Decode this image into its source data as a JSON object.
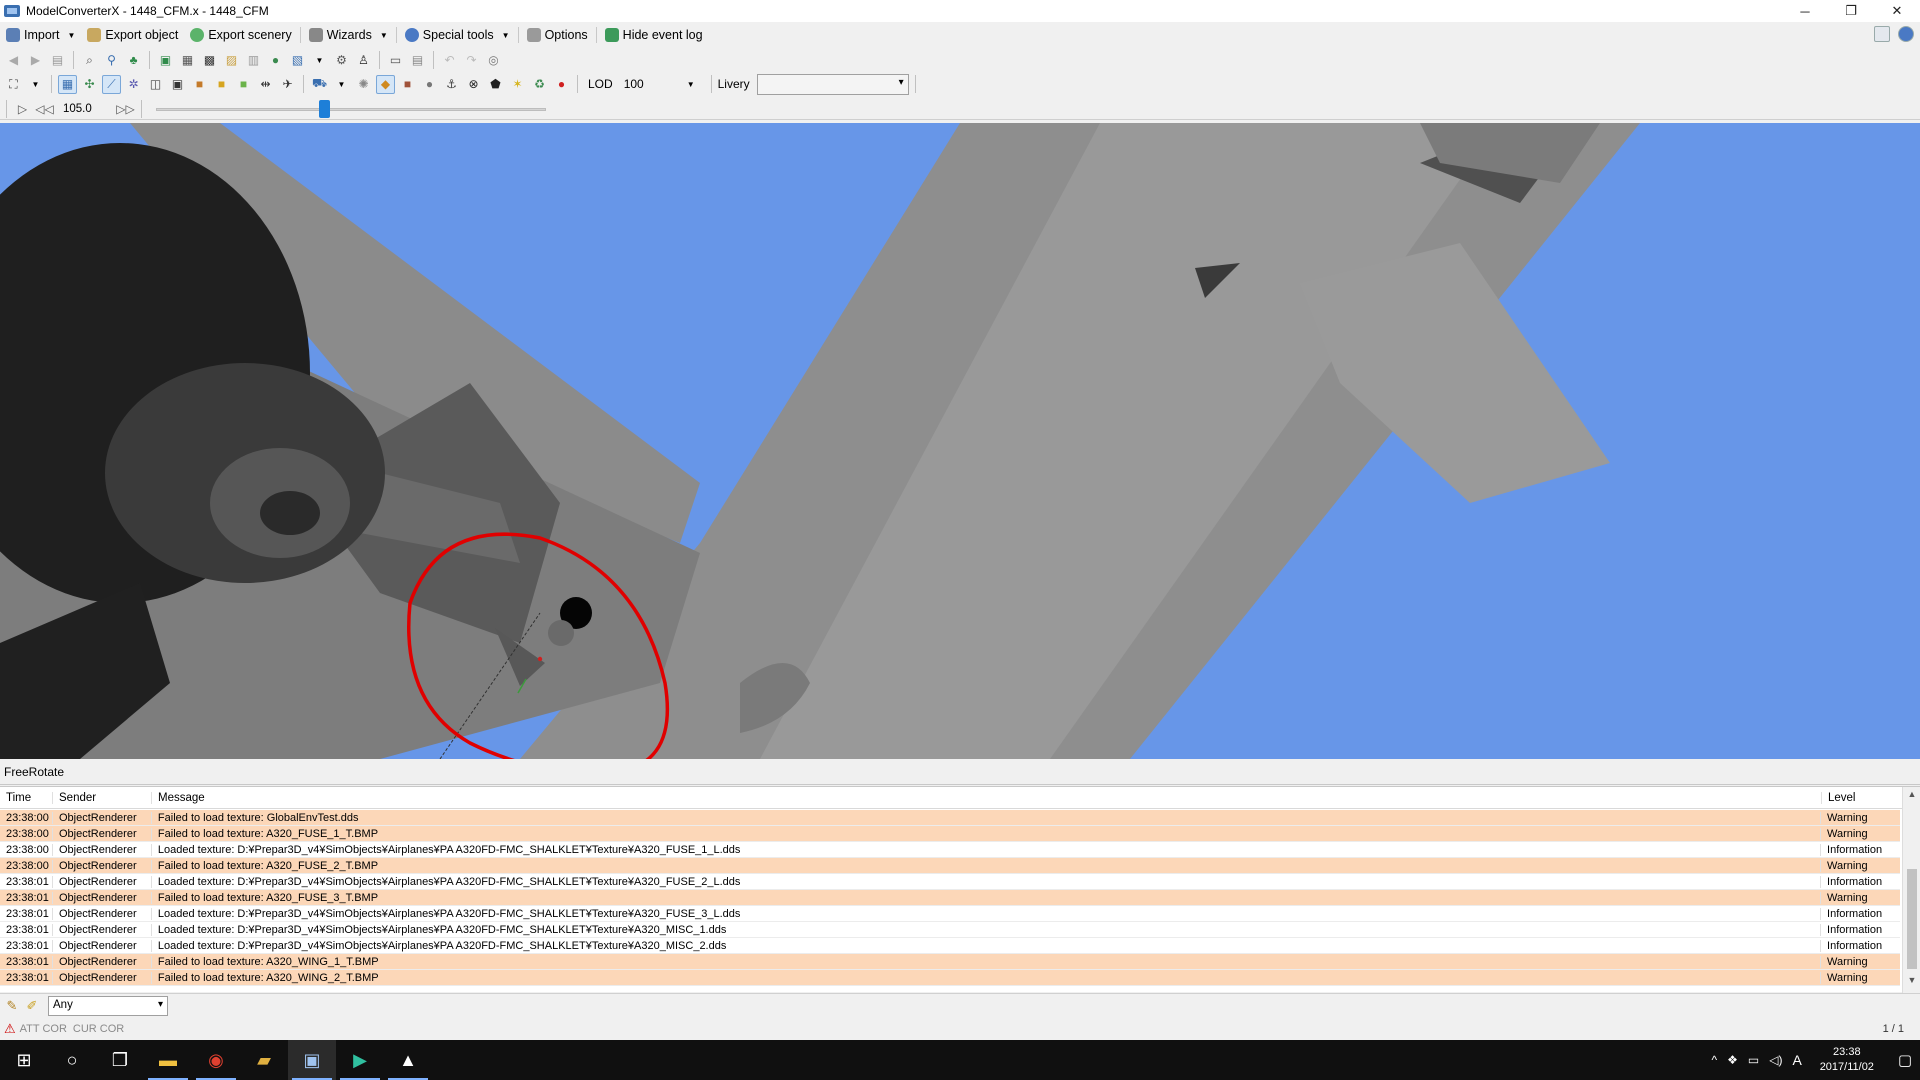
{
  "window": {
    "title": "ModelConverterX - 1448_CFM.x - 1448_CFM",
    "minimize": "─",
    "restore": "❐",
    "close": "✕"
  },
  "menu": {
    "import": "Import",
    "export_object": "Export object",
    "export_scenery": "Export scenery",
    "wizards": "Wizards",
    "special_tools": "Special tools",
    "options": "Options",
    "hide_event_log": "Hide event log"
  },
  "toolbar2": {
    "lod_label": "LOD",
    "lod_value": "100",
    "livery_label": "Livery",
    "livery_value": ""
  },
  "playback": {
    "speed_value": "105.0",
    "slider_position": 0.43
  },
  "mode_label": "FreeRotate",
  "log": {
    "columns": {
      "time": "Time",
      "sender": "Sender",
      "message": "Message",
      "level": "Level"
    },
    "rows": [
      {
        "time": "23:38:00",
        "sender": "ObjectRenderer",
        "message": "Failed to load texture: GlobalEnvTest.dds",
        "level": "Warning"
      },
      {
        "time": "23:38:00",
        "sender": "ObjectRenderer",
        "message": "Failed to load texture: A320_FUSE_1_T.BMP",
        "level": "Warning"
      },
      {
        "time": "23:38:00",
        "sender": "ObjectRenderer",
        "message": "Loaded texture: D:¥Prepar3D_v4¥SimObjects¥Airplanes¥PA A320FD-FMC_SHALKLET¥Texture¥A320_FUSE_1_L.dds",
        "level": "Information"
      },
      {
        "time": "23:38:00",
        "sender": "ObjectRenderer",
        "message": "Failed to load texture: A320_FUSE_2_T.BMP",
        "level": "Warning"
      },
      {
        "time": "23:38:01",
        "sender": "ObjectRenderer",
        "message": "Loaded texture: D:¥Prepar3D_v4¥SimObjects¥Airplanes¥PA A320FD-FMC_SHALKLET¥Texture¥A320_FUSE_2_L.dds",
        "level": "Information"
      },
      {
        "time": "23:38:01",
        "sender": "ObjectRenderer",
        "message": "Failed to load texture: A320_FUSE_3_T.BMP",
        "level": "Warning"
      },
      {
        "time": "23:38:01",
        "sender": "ObjectRenderer",
        "message": "Loaded texture: D:¥Prepar3D_v4¥SimObjects¥Airplanes¥PA A320FD-FMC_SHALKLET¥Texture¥A320_FUSE_3_L.dds",
        "level": "Information"
      },
      {
        "time": "23:38:01",
        "sender": "ObjectRenderer",
        "message": "Loaded texture: D:¥Prepar3D_v4¥SimObjects¥Airplanes¥PA A320FD-FMC_SHALKLET¥Texture¥A320_MISC_1.dds",
        "level": "Information"
      },
      {
        "time": "23:38:01",
        "sender": "ObjectRenderer",
        "message": "Loaded texture: D:¥Prepar3D_v4¥SimObjects¥Airplanes¥PA A320FD-FMC_SHALKLET¥Texture¥A320_MISC_2.dds",
        "level": "Information"
      },
      {
        "time": "23:38:01",
        "sender": "ObjectRenderer",
        "message": "Failed to load texture: A320_WING_1_T.BMP",
        "level": "Warning"
      },
      {
        "time": "23:38:01",
        "sender": "ObjectRenderer",
        "message": "Failed to load texture: A320_WING_2_T.BMP",
        "level": "Warning"
      }
    ]
  },
  "filter": {
    "value": "Any"
  },
  "status": {
    "att_cor": "ATT COR",
    "cur_cor": "CUR COR",
    "page": "1 / 1"
  },
  "taskbar": {
    "time": "23:38",
    "date": "2017/11/02",
    "ime": "A"
  },
  "colors": {
    "viewport_sky": "#6796e8",
    "warning_row": "#fcd7b8",
    "annotation_circle": "#e00000"
  }
}
